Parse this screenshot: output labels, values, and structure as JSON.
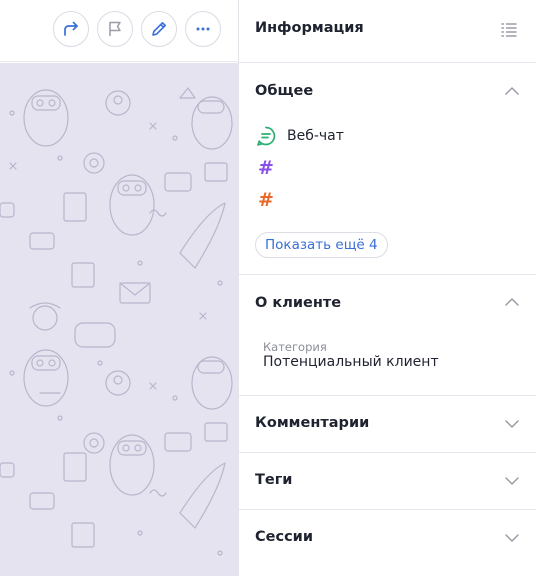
{
  "toolbar": {
    "buttons": [
      {
        "icon": "forward-arrow-icon"
      },
      {
        "icon": "flag-icon"
      },
      {
        "icon": "pencil-icon"
      },
      {
        "icon": "more-dots-icon"
      }
    ]
  },
  "info": {
    "title": "Информация",
    "sections": {
      "general": {
        "title": "Общее",
        "channels": [
          {
            "label": "Веб-чат",
            "icon": "chat-bubble-icon",
            "color": "#2fae72"
          },
          {
            "label": "",
            "icon": "#",
            "color": "#8a4fe8"
          },
          {
            "label": "",
            "icon": "#",
            "color": "#e8692a"
          }
        ],
        "show_more": "Показать ещё 4"
      },
      "client": {
        "title": "О клиенте",
        "field_label": "Категория",
        "field_value": "Потенциальный клиент"
      },
      "comments": {
        "title": "Комментарии"
      },
      "tags": {
        "title": "Теги"
      },
      "sessions": {
        "title": "Сессии"
      }
    }
  },
  "colors": {
    "accent": "#3a6fd8",
    "chat_background": "#e6e3f1",
    "pattern": "#b9b5cc"
  }
}
